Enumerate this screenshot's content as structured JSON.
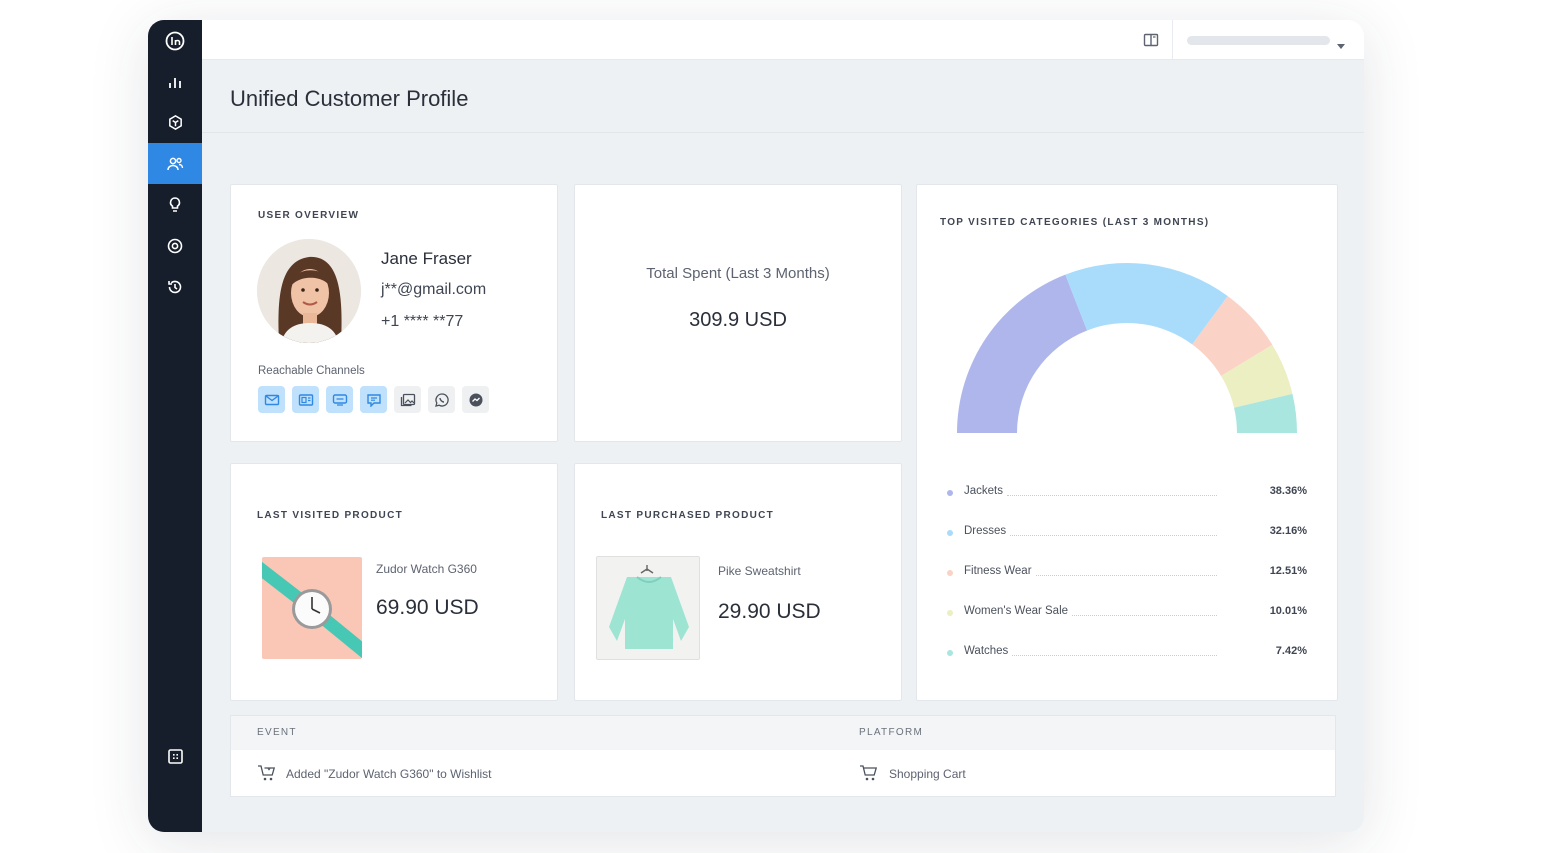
{
  "app": {
    "title": "Unified Customer Profile",
    "accent": "#2f88e4",
    "sidebar_bg": "#161d2b"
  },
  "sidebar": {
    "items": [
      {
        "name": "logo-icon"
      },
      {
        "name": "analytics-icon"
      },
      {
        "name": "box-icon"
      },
      {
        "name": "users-icon",
        "active": true
      },
      {
        "name": "lightbulb-icon"
      },
      {
        "name": "target-icon"
      },
      {
        "name": "history-icon"
      },
      {
        "name": "grid-icon"
      }
    ]
  },
  "user_overview": {
    "label": "USER OVERVIEW",
    "name": "Jane Fraser",
    "email": "j**@gmail.com",
    "phone": "+1 **** **77",
    "channels_label": "Reachable Channels",
    "channels": [
      {
        "name": "email-icon",
        "enabled": true
      },
      {
        "name": "browser-push-icon",
        "enabled": true
      },
      {
        "name": "sms-icon",
        "enabled": true
      },
      {
        "name": "chat-icon",
        "enabled": true
      },
      {
        "name": "gallery-icon",
        "enabled": false
      },
      {
        "name": "whatsapp-icon",
        "enabled": false
      },
      {
        "name": "messenger-icon",
        "enabled": false
      }
    ]
  },
  "total_spent": {
    "label": "Total Spent (Last 3 Months)",
    "value": "309.9 USD"
  },
  "top_categories": {
    "label": "TOP VISITED CATEGORIES (LAST 3 MONTHS)"
  },
  "chart_data": {
    "type": "pie",
    "title": "TOP VISITED CATEGORIES (LAST 3 MONTHS)",
    "categories": [
      "Jackets",
      "Dresses",
      "Fitness Wear",
      "Women's Wear Sale",
      "Watches"
    ],
    "values": [
      38.36,
      32.16,
      12.51,
      10.01,
      7.42
    ],
    "value_labels": [
      "38.36%",
      "32.16%",
      "12.51%",
      "10.01%",
      "7.42%"
    ],
    "colors": [
      "#aeb6ec",
      "#a9dcfb",
      "#fbd2c6",
      "#ecefc2",
      "#a9e6df"
    ],
    "legend": "bottom"
  },
  "last_visited": {
    "label": "LAST VISITED PRODUCT",
    "product": "Zudor Watch G360",
    "price": "69.90 USD"
  },
  "last_purchased": {
    "label": "LAST PURCHASED PRODUCT",
    "product": "Pike Sweatshirt",
    "price": "29.90 USD"
  },
  "events": {
    "columns": [
      "EVENT",
      "PLATFORM"
    ],
    "rows": [
      {
        "event": "Added \"Zudor Watch G360\" to Wishlist",
        "platform": "Shopping Cart"
      }
    ]
  }
}
